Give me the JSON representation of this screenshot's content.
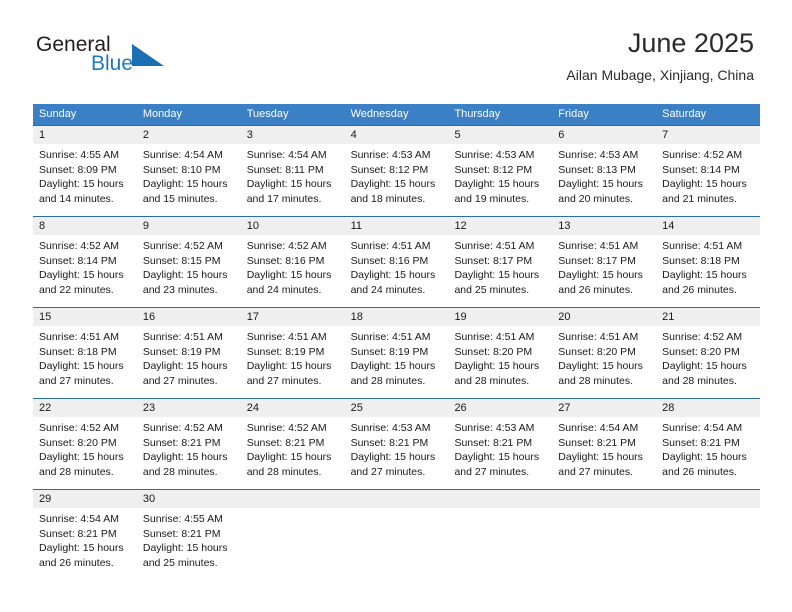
{
  "brand": {
    "name_part1": "General",
    "name_part2": "Blue"
  },
  "header": {
    "title": "June 2025",
    "subtitle": "Ailan Mubage, Xinjiang, China"
  },
  "calendar": {
    "weekdays": [
      "Sunday",
      "Monday",
      "Tuesday",
      "Wednesday",
      "Thursday",
      "Friday",
      "Saturday"
    ],
    "colors": {
      "header_blue": "#3b7fc4",
      "separator_blue": "#2e6da4",
      "daynum_band": "#efefef",
      "logo_blue": "#1f7ac2"
    },
    "weeks": [
      [
        {
          "day": "1",
          "sunrise": "Sunrise: 4:55 AM",
          "sunset": "Sunset: 8:09 PM",
          "daylight1": "Daylight: 15 hours",
          "daylight2": "and 14 minutes."
        },
        {
          "day": "2",
          "sunrise": "Sunrise: 4:54 AM",
          "sunset": "Sunset: 8:10 PM",
          "daylight1": "Daylight: 15 hours",
          "daylight2": "and 15 minutes."
        },
        {
          "day": "3",
          "sunrise": "Sunrise: 4:54 AM",
          "sunset": "Sunset: 8:11 PM",
          "daylight1": "Daylight: 15 hours",
          "daylight2": "and 17 minutes."
        },
        {
          "day": "4",
          "sunrise": "Sunrise: 4:53 AM",
          "sunset": "Sunset: 8:12 PM",
          "daylight1": "Daylight: 15 hours",
          "daylight2": "and 18 minutes."
        },
        {
          "day": "5",
          "sunrise": "Sunrise: 4:53 AM",
          "sunset": "Sunset: 8:12 PM",
          "daylight1": "Daylight: 15 hours",
          "daylight2": "and 19 minutes."
        },
        {
          "day": "6",
          "sunrise": "Sunrise: 4:53 AM",
          "sunset": "Sunset: 8:13 PM",
          "daylight1": "Daylight: 15 hours",
          "daylight2": "and 20 minutes."
        },
        {
          "day": "7",
          "sunrise": "Sunrise: 4:52 AM",
          "sunset": "Sunset: 8:14 PM",
          "daylight1": "Daylight: 15 hours",
          "daylight2": "and 21 minutes."
        }
      ],
      [
        {
          "day": "8",
          "sunrise": "Sunrise: 4:52 AM",
          "sunset": "Sunset: 8:14 PM",
          "daylight1": "Daylight: 15 hours",
          "daylight2": "and 22 minutes."
        },
        {
          "day": "9",
          "sunrise": "Sunrise: 4:52 AM",
          "sunset": "Sunset: 8:15 PM",
          "daylight1": "Daylight: 15 hours",
          "daylight2": "and 23 minutes."
        },
        {
          "day": "10",
          "sunrise": "Sunrise: 4:52 AM",
          "sunset": "Sunset: 8:16 PM",
          "daylight1": "Daylight: 15 hours",
          "daylight2": "and 24 minutes."
        },
        {
          "day": "11",
          "sunrise": "Sunrise: 4:51 AM",
          "sunset": "Sunset: 8:16 PM",
          "daylight1": "Daylight: 15 hours",
          "daylight2": "and 24 minutes."
        },
        {
          "day": "12",
          "sunrise": "Sunrise: 4:51 AM",
          "sunset": "Sunset: 8:17 PM",
          "daylight1": "Daylight: 15 hours",
          "daylight2": "and 25 minutes."
        },
        {
          "day": "13",
          "sunrise": "Sunrise: 4:51 AM",
          "sunset": "Sunset: 8:17 PM",
          "daylight1": "Daylight: 15 hours",
          "daylight2": "and 26 minutes."
        },
        {
          "day": "14",
          "sunrise": "Sunrise: 4:51 AM",
          "sunset": "Sunset: 8:18 PM",
          "daylight1": "Daylight: 15 hours",
          "daylight2": "and 26 minutes."
        }
      ],
      [
        {
          "day": "15",
          "sunrise": "Sunrise: 4:51 AM",
          "sunset": "Sunset: 8:18 PM",
          "daylight1": "Daylight: 15 hours",
          "daylight2": "and 27 minutes."
        },
        {
          "day": "16",
          "sunrise": "Sunrise: 4:51 AM",
          "sunset": "Sunset: 8:19 PM",
          "daylight1": "Daylight: 15 hours",
          "daylight2": "and 27 minutes."
        },
        {
          "day": "17",
          "sunrise": "Sunrise: 4:51 AM",
          "sunset": "Sunset: 8:19 PM",
          "daylight1": "Daylight: 15 hours",
          "daylight2": "and 27 minutes."
        },
        {
          "day": "18",
          "sunrise": "Sunrise: 4:51 AM",
          "sunset": "Sunset: 8:19 PM",
          "daylight1": "Daylight: 15 hours",
          "daylight2": "and 28 minutes."
        },
        {
          "day": "19",
          "sunrise": "Sunrise: 4:51 AM",
          "sunset": "Sunset: 8:20 PM",
          "daylight1": "Daylight: 15 hours",
          "daylight2": "and 28 minutes."
        },
        {
          "day": "20",
          "sunrise": "Sunrise: 4:51 AM",
          "sunset": "Sunset: 8:20 PM",
          "daylight1": "Daylight: 15 hours",
          "daylight2": "and 28 minutes."
        },
        {
          "day": "21",
          "sunrise": "Sunrise: 4:52 AM",
          "sunset": "Sunset: 8:20 PM",
          "daylight1": "Daylight: 15 hours",
          "daylight2": "and 28 minutes."
        }
      ],
      [
        {
          "day": "22",
          "sunrise": "Sunrise: 4:52 AM",
          "sunset": "Sunset: 8:20 PM",
          "daylight1": "Daylight: 15 hours",
          "daylight2": "and 28 minutes."
        },
        {
          "day": "23",
          "sunrise": "Sunrise: 4:52 AM",
          "sunset": "Sunset: 8:21 PM",
          "daylight1": "Daylight: 15 hours",
          "daylight2": "and 28 minutes."
        },
        {
          "day": "24",
          "sunrise": "Sunrise: 4:52 AM",
          "sunset": "Sunset: 8:21 PM",
          "daylight1": "Daylight: 15 hours",
          "daylight2": "and 28 minutes."
        },
        {
          "day": "25",
          "sunrise": "Sunrise: 4:53 AM",
          "sunset": "Sunset: 8:21 PM",
          "daylight1": "Daylight: 15 hours",
          "daylight2": "and 27 minutes."
        },
        {
          "day": "26",
          "sunrise": "Sunrise: 4:53 AM",
          "sunset": "Sunset: 8:21 PM",
          "daylight1": "Daylight: 15 hours",
          "daylight2": "and 27 minutes."
        },
        {
          "day": "27",
          "sunrise": "Sunrise: 4:54 AM",
          "sunset": "Sunset: 8:21 PM",
          "daylight1": "Daylight: 15 hours",
          "daylight2": "and 27 minutes."
        },
        {
          "day": "28",
          "sunrise": "Sunrise: 4:54 AM",
          "sunset": "Sunset: 8:21 PM",
          "daylight1": "Daylight: 15 hours",
          "daylight2": "and 26 minutes."
        }
      ],
      [
        {
          "day": "29",
          "sunrise": "Sunrise: 4:54 AM",
          "sunset": "Sunset: 8:21 PM",
          "daylight1": "Daylight: 15 hours",
          "daylight2": "and 26 minutes."
        },
        {
          "day": "30",
          "sunrise": "Sunrise: 4:55 AM",
          "sunset": "Sunset: 8:21 PM",
          "daylight1": "Daylight: 15 hours",
          "daylight2": "and 25 minutes."
        },
        {
          "day": "",
          "sunrise": "",
          "sunset": "",
          "daylight1": "",
          "daylight2": ""
        },
        {
          "day": "",
          "sunrise": "",
          "sunset": "",
          "daylight1": "",
          "daylight2": ""
        },
        {
          "day": "",
          "sunrise": "",
          "sunset": "",
          "daylight1": "",
          "daylight2": ""
        },
        {
          "day": "",
          "sunrise": "",
          "sunset": "",
          "daylight1": "",
          "daylight2": ""
        },
        {
          "day": "",
          "sunrise": "",
          "sunset": "",
          "daylight1": "",
          "daylight2": ""
        }
      ]
    ]
  }
}
